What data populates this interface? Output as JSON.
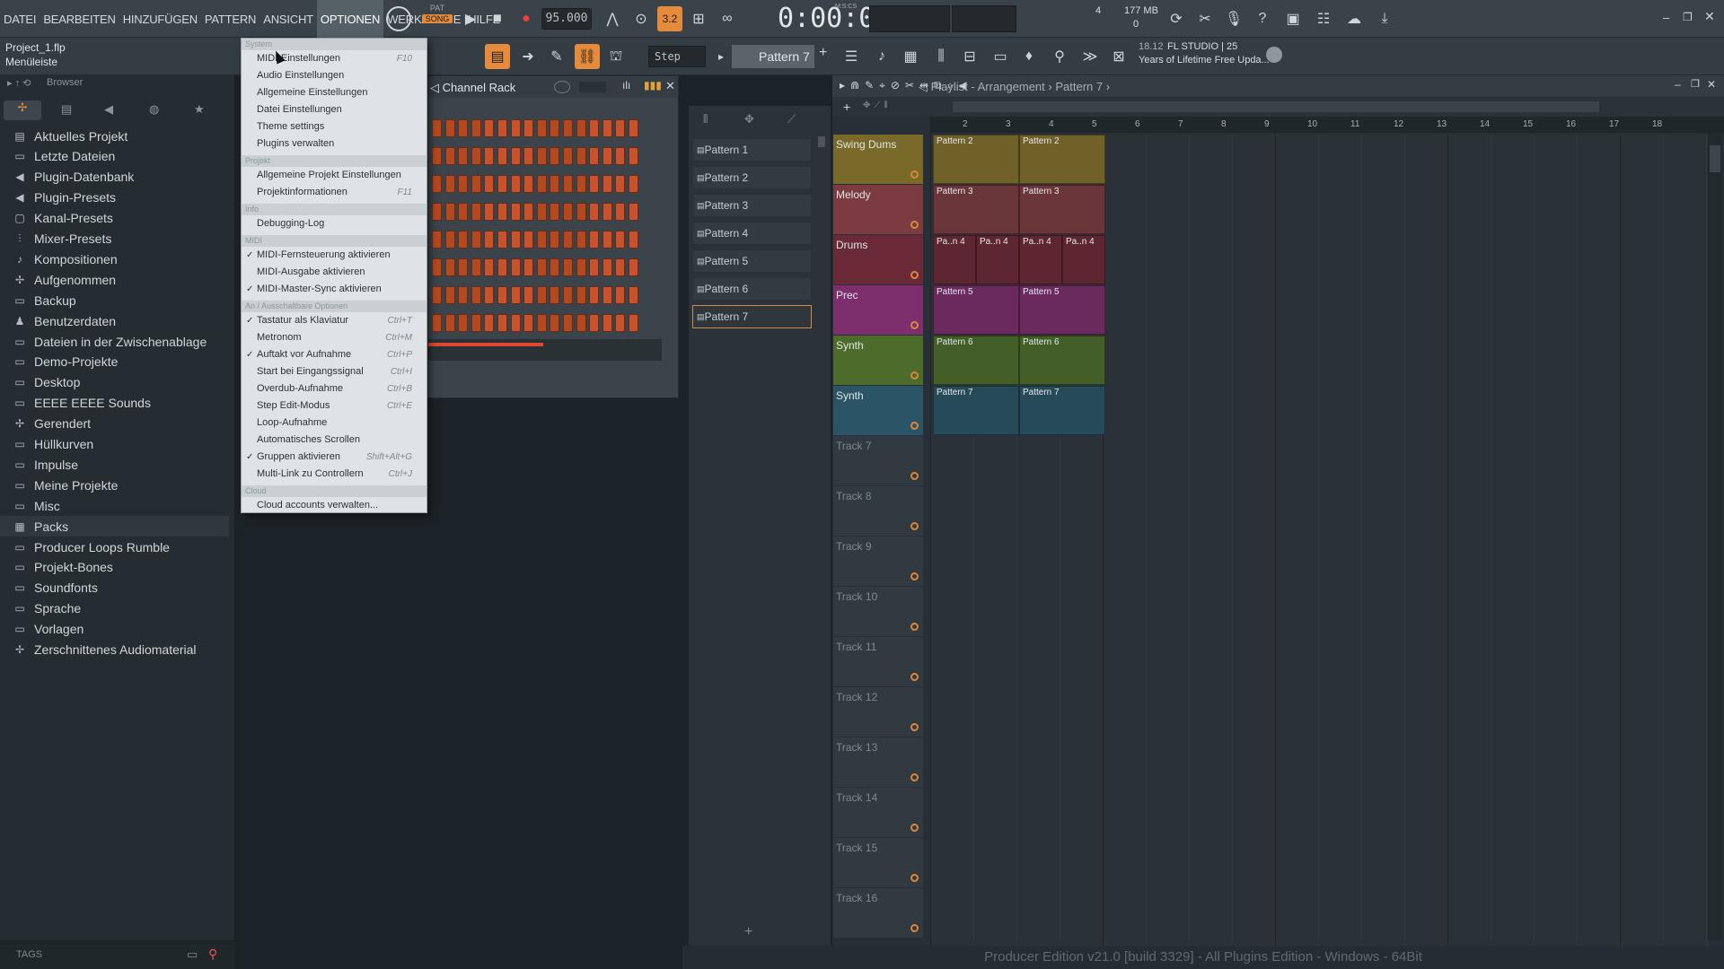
{
  "menubar": {
    "items": [
      "DATEI",
      "BEARBEITEN",
      "HINZUFÜGEN",
      "PATTERN",
      "ANSICHT",
      "OPTIONEN",
      "WERKZEUGE",
      "HILFE"
    ],
    "active": "OPTIONEN"
  },
  "transport": {
    "mode_label": "SONG",
    "mode_label_small": "PAT",
    "tempo": "95.000",
    "time": "0:00:00",
    "time_unit": "M:S:CS",
    "cpu_value": "4",
    "memory": "177 MB",
    "memory_sub": "0"
  },
  "project": {
    "filename": "Project_1.flp",
    "hint": "Menüleiste"
  },
  "toolbar2": {
    "snap": "Step",
    "pattern": "Pattern 7",
    "news_date": "18.12",
    "news_title": "FL STUDIO | 25",
    "news_text": "Years of Lifetime Free Upda..."
  },
  "browser": {
    "title": "Browser",
    "tags_label": "TAGS",
    "items": [
      {
        "label": "Aktuelles Projekt",
        "icon": "project-icon"
      },
      {
        "label": "Letzte Dateien",
        "icon": "recent-files-icon"
      },
      {
        "label": "Plugin-Datenbank",
        "icon": "plugin-database-icon"
      },
      {
        "label": "Plugin-Presets",
        "icon": "plugin-presets-icon"
      },
      {
        "label": "Kanal-Presets",
        "icon": "channel-presets-icon"
      },
      {
        "label": "Mixer-Presets",
        "icon": "mixer-presets-icon"
      },
      {
        "label": "Kompositionen",
        "icon": "note-icon"
      },
      {
        "label": "Aufgenommen",
        "icon": "recorded-icon"
      },
      {
        "label": "Backup",
        "icon": "backup-icon"
      },
      {
        "label": "Benutzerdaten",
        "icon": "user-data-icon"
      },
      {
        "label": "Dateien in der Zwischenablage",
        "icon": "folder-icon"
      },
      {
        "label": "Demo-Projekte",
        "icon": "folder-icon"
      },
      {
        "label": "Desktop",
        "icon": "folder-icon"
      },
      {
        "label": "EEEE EEEE Sounds",
        "icon": "folder-icon"
      },
      {
        "label": "Gerendert",
        "icon": "rendered-icon"
      },
      {
        "label": "Hüllkurven",
        "icon": "folder-icon"
      },
      {
        "label": "Impulse",
        "icon": "folder-icon"
      },
      {
        "label": "Meine Projekte",
        "icon": "folder-icon"
      },
      {
        "label": "Misc",
        "icon": "folder-icon"
      },
      {
        "label": "Packs",
        "icon": "packs-icon"
      },
      {
        "label": "Producer Loops Rumble",
        "icon": "folder-icon"
      },
      {
        "label": "Projekt-Bones",
        "icon": "folder-icon"
      },
      {
        "label": "Soundfonts",
        "icon": "folder-icon"
      },
      {
        "label": "Sprache",
        "icon": "folder-icon"
      },
      {
        "label": "Vorlagen",
        "icon": "folder-icon"
      },
      {
        "label": "Zerschnittenes Audiomaterial",
        "icon": "sliced-audio-icon"
      }
    ],
    "selected": "Packs"
  },
  "dropdown": {
    "sections": [
      {
        "title": "System",
        "items": [
          {
            "label": "MIDI-Einstellungen",
            "shortcut": "F10",
            "checked": false
          },
          {
            "label": "Audio Einstellungen",
            "shortcut": "",
            "checked": false
          },
          {
            "label": "Allgemeine Einstellungen",
            "shortcut": "",
            "checked": false
          },
          {
            "label": "Datei Einstellungen",
            "shortcut": "",
            "checked": false
          },
          {
            "label": "Theme settings",
            "shortcut": "",
            "checked": false
          },
          {
            "label": "Plugins verwalten",
            "shortcut": "",
            "checked": false
          }
        ]
      },
      {
        "title": "Projekt",
        "items": [
          {
            "label": "Allgemeine Projekt Einstellungen",
            "shortcut": "",
            "checked": false
          },
          {
            "label": "Projektinformationen",
            "shortcut": "F11",
            "checked": false
          }
        ]
      },
      {
        "title": "Info",
        "items": [
          {
            "label": "Debugging-Log",
            "shortcut": "",
            "checked": false
          }
        ]
      },
      {
        "title": "MIDI",
        "items": [
          {
            "label": "MIDI-Fernsteuerung aktivieren",
            "shortcut": "",
            "checked": true
          },
          {
            "label": "MIDI-Ausgabe aktivieren",
            "shortcut": "",
            "checked": false
          },
          {
            "label": "MIDI-Master-Sync aktivieren",
            "shortcut": "",
            "checked": true
          }
        ]
      },
      {
        "title": "An / Ausschaltbare Optionen",
        "items": [
          {
            "label": "Tastatur als Klaviatur",
            "shortcut": "Ctrl+T",
            "checked": true
          },
          {
            "label": "Metronom",
            "shortcut": "Ctrl+M",
            "checked": false
          },
          {
            "label": "Auftakt vor Aufnahme",
            "shortcut": "Ctrl+P",
            "checked": true
          },
          {
            "label": "Start bei Eingangssignal",
            "shortcut": "Ctrl+I",
            "checked": false
          },
          {
            "label": "Overdub-Aufnahme",
            "shortcut": "Ctrl+B",
            "checked": false
          },
          {
            "label": "Step Edit-Modus",
            "shortcut": "Ctrl+E",
            "checked": false
          },
          {
            "label": "Loop-Aufnahme",
            "shortcut": "",
            "checked": false
          },
          {
            "label": "Automatisches Scrollen",
            "shortcut": "",
            "checked": false
          },
          {
            "label": "Gruppen aktivieren",
            "shortcut": "Shift+Alt+G",
            "checked": true
          },
          {
            "label": "Multi-Link zu Controllern",
            "shortcut": "Ctrl+J",
            "checked": false
          }
        ]
      },
      {
        "title": "Cloud",
        "items": [
          {
            "label": "Cloud accounts verwalten...",
            "shortcut": "",
            "checked": false
          }
        ]
      }
    ]
  },
  "channel_rack": {
    "title": "Channel Rack"
  },
  "patterns": [
    "Pattern 1",
    "Pattern 2",
    "Pattern 3",
    "Pattern 4",
    "Pattern 5",
    "Pattern 6",
    "Pattern 7"
  ],
  "selected_pattern": "Pattern 7",
  "playlist": {
    "title": "Playlist - Arrangement",
    "crumb": "Pattern 7",
    "ruler": [
      "2",
      "3",
      "4",
      "5",
      "6",
      "7",
      "8",
      "9",
      "10",
      "11",
      "12",
      "13",
      "14",
      "15",
      "16",
      "17",
      "18"
    ],
    "tracks": [
      {
        "name": "Swing Dums",
        "color": "#7a6a2a",
        "clip_color": "#6f6128",
        "clips": [
          "Pattern 2",
          "Pattern 2"
        ]
      },
      {
        "name": "Melody",
        "color": "#7b3c41",
        "clip_color": "#6a363a",
        "clips": [
          "Pattern 3",
          "Pattern 3"
        ]
      },
      {
        "name": "Drums",
        "color": "#6a2a38",
        "clip_color": "#5e2631",
        "clips": [
          "Pa..n 4",
          "Pa..n 4",
          "Pa..n 4",
          "Pa..n 4"
        ]
      },
      {
        "name": "Prec",
        "color": "#7d2f6d",
        "clip_color": "#6a2a5e",
        "clips": [
          "Pattern 5",
          "Pattern 5"
        ]
      },
      {
        "name": "Synth",
        "color": "#4d6b2a",
        "clip_color": "#435e26",
        "clips": [
          "Pattern 6",
          "Pattern 6"
        ]
      },
      {
        "name": "Synth",
        "color": "#2a5566",
        "clip_color": "#264a58",
        "clips": [
          "Pattern 7",
          "Pattern 7"
        ]
      },
      {
        "name": "Track 7"
      },
      {
        "name": "Track 8"
      },
      {
        "name": "Track 9"
      },
      {
        "name": "Track 10"
      },
      {
        "name": "Track 11"
      },
      {
        "name": "Track 12"
      },
      {
        "name": "Track 13"
      },
      {
        "name": "Track 14"
      },
      {
        "name": "Track 15"
      },
      {
        "name": "Track 16"
      }
    ]
  },
  "status_bar": "Producer Edition v21.0 [build 3329] - All Plugins Edition - Windows - 64Bit"
}
